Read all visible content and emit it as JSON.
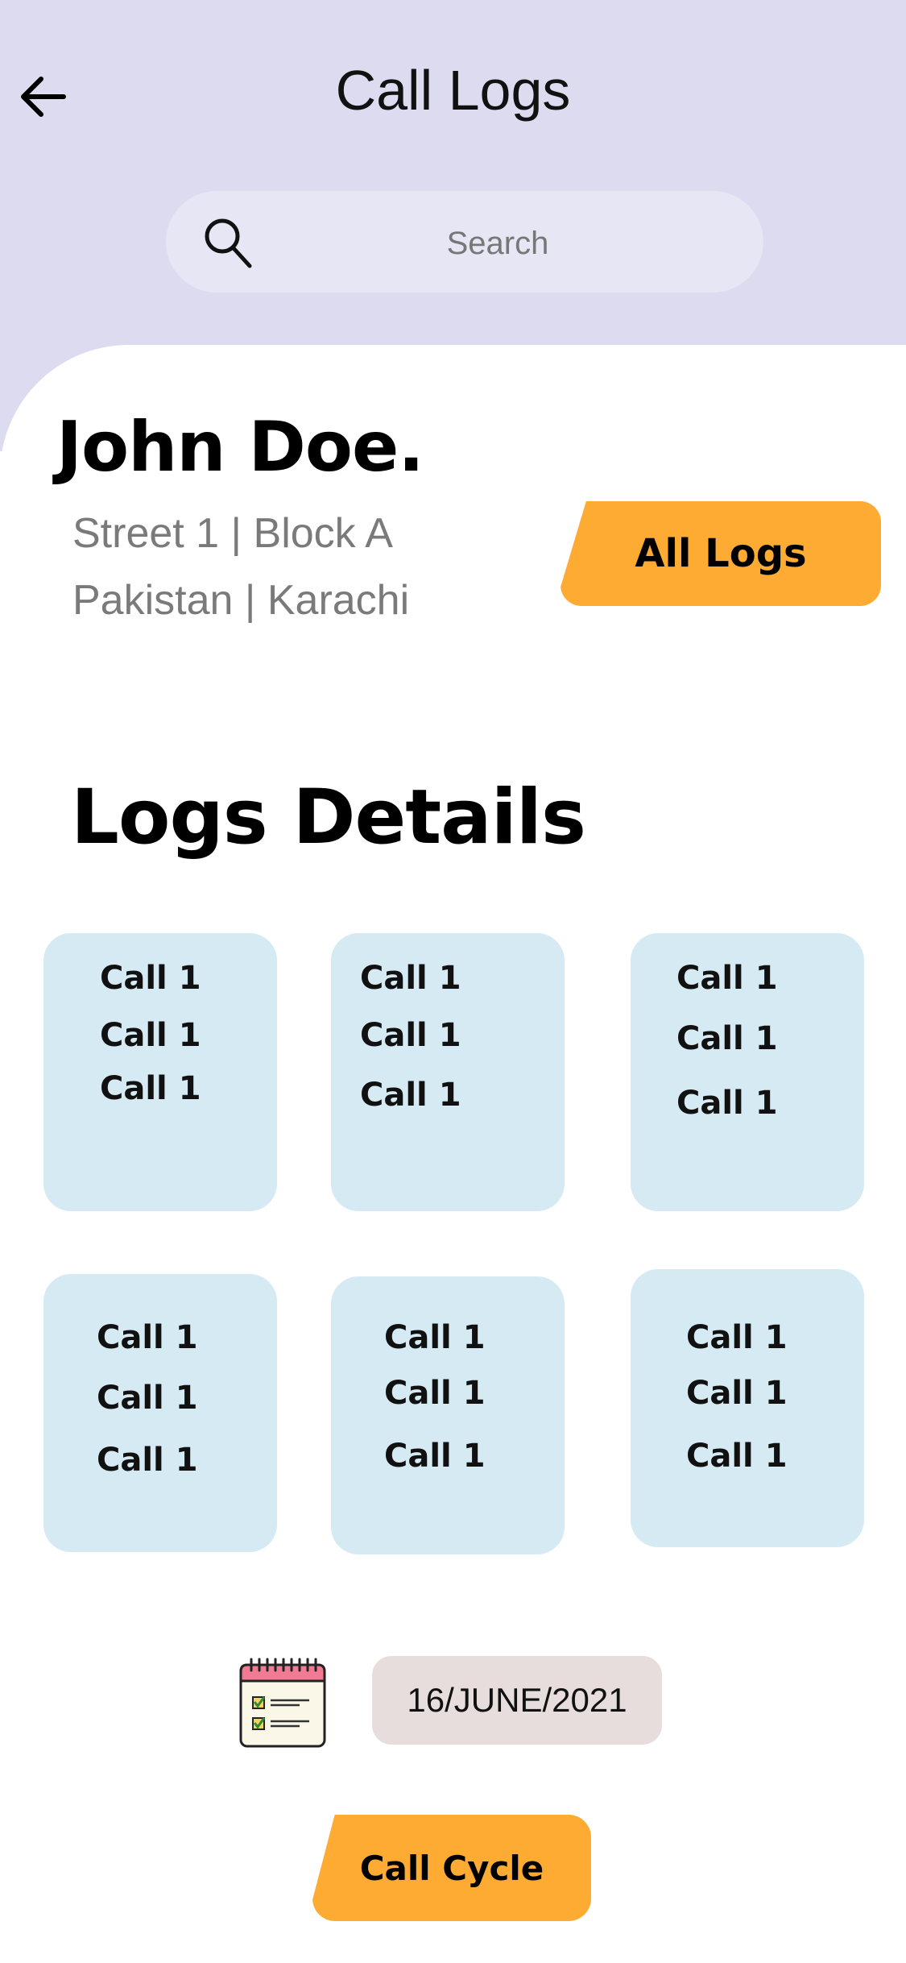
{
  "header": {
    "title": "Call Logs",
    "back_icon": "arrow-left-icon"
  },
  "search": {
    "placeholder": "Search",
    "icon": "search-icon"
  },
  "contact": {
    "name": "John Doe.",
    "address_line1": "Street 1 | Block A",
    "address_line2": "Pakistan | Karachi",
    "all_logs_label": "All Logs"
  },
  "logs": {
    "title": "Logs Details",
    "cards": [
      {
        "lines": [
          "Call 1",
          "Call 1",
          "Call 1"
        ]
      },
      {
        "lines": [
          "Call 1",
          "Call 1",
          "Call 1"
        ]
      },
      {
        "lines": [
          "Call 1",
          "Call 1",
          "Call 1"
        ]
      },
      {
        "lines": [
          "Call 1",
          "Call 1",
          "Call 1"
        ]
      },
      {
        "lines": [
          "Call 1",
          "Call 1",
          "Call 1"
        ]
      },
      {
        "lines": [
          "Call 1",
          "Call 1",
          "Call 1"
        ]
      }
    ]
  },
  "footer": {
    "calendar_icon": "calendar-checklist-icon",
    "date": "16/JUNE/2021",
    "call_cycle_label": "Call Cycle"
  },
  "colors": {
    "header_bg": "#dcdbf0",
    "accent": "#fdab33",
    "card_bg": "#d5eaf3"
  }
}
